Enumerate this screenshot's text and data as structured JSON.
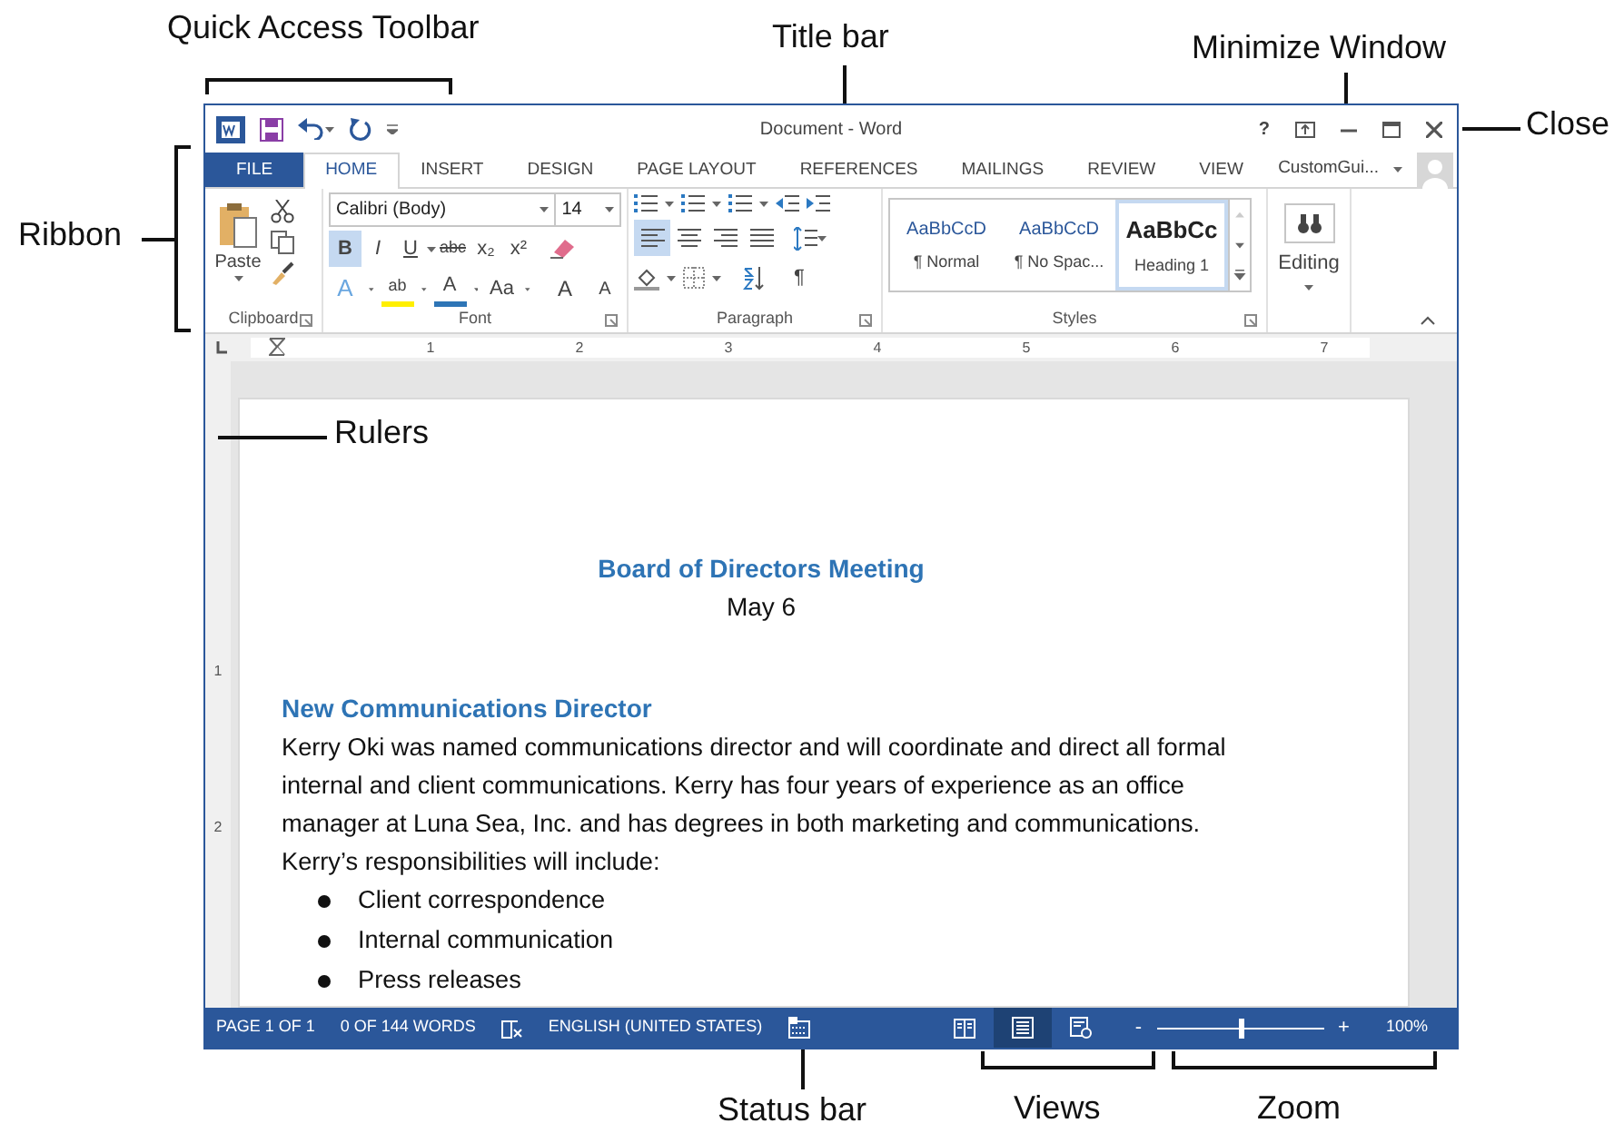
{
  "annotations": [
    {
      "label": "Quick Access Toolbar"
    },
    {
      "label": "Title bar"
    },
    {
      "label": "Minimize Window"
    },
    {
      "label": "Close"
    },
    {
      "label": "Ribbon"
    },
    {
      "label": "Rulers"
    },
    {
      "label": "Status bar"
    },
    {
      "label": "Views"
    },
    {
      "label": "Zoom"
    }
  ],
  "window": {
    "title": "Document - Word",
    "help": "?"
  },
  "tabs": [
    {
      "label": "FILE",
      "kind": "file",
      "selected": false
    },
    {
      "label": "HOME",
      "kind": "tab",
      "selected": true
    },
    {
      "label": "INSERT",
      "kind": "tab",
      "selected": false
    },
    {
      "label": "DESIGN",
      "kind": "tab",
      "selected": false
    },
    {
      "label": "PAGE LAYOUT",
      "kind": "tab",
      "selected": false
    },
    {
      "label": "REFERENCES",
      "kind": "tab",
      "selected": false
    },
    {
      "label": "MAILINGS",
      "kind": "tab",
      "selected": false
    },
    {
      "label": "REVIEW",
      "kind": "tab",
      "selected": false
    },
    {
      "label": "VIEW",
      "kind": "tab",
      "selected": false
    }
  ],
  "account": {
    "name": "CustomGui..."
  },
  "clipboard": {
    "label": "Clipboard",
    "paste": "Paste"
  },
  "font": {
    "label": "Font",
    "font_name": "Calibri (Body)",
    "font_size": "14",
    "format_buttons": [
      {
        "kind": "bold",
        "label": "B",
        "selected": true
      },
      {
        "kind": "italic",
        "label": "I",
        "selected": false
      },
      {
        "kind": "underline",
        "label": "U",
        "selected": false
      },
      {
        "kind": "strike",
        "label": "abc",
        "selected": false
      },
      {
        "kind": "plain",
        "label": "x₂",
        "selected": false
      },
      {
        "kind": "plain",
        "label": "x²",
        "selected": false
      }
    ],
    "effect_buttons": [
      {
        "kind": "effects",
        "label": "A"
      },
      {
        "kind": "highlight",
        "label": "ab"
      },
      {
        "kind": "color",
        "label": "A"
      },
      {
        "kind": "case",
        "label": "Aa"
      },
      {
        "kind": "grow",
        "label": "A"
      },
      {
        "kind": "shrink",
        "label": "A"
      }
    ]
  },
  "paragraph": {
    "label": "Paragraph",
    "align_buttons": [
      {
        "kind": "left",
        "selected": true
      },
      {
        "kind": "center",
        "selected": false
      },
      {
        "kind": "right",
        "selected": false
      },
      {
        "kind": "justify",
        "selected": false
      }
    ],
    "pilcrow": "¶"
  },
  "styles": {
    "label": "Styles",
    "items": [
      {
        "preview": "AaBbCcD",
        "name": "¶ Normal",
        "selected": false
      },
      {
        "preview": "AaBbCcD",
        "name": "¶ No Spac...",
        "selected": false
      },
      {
        "preview": "AaBbCc",
        "name": "Heading 1",
        "selected": true
      }
    ]
  },
  "editing": {
    "label": "Editing"
  },
  "ruler": [
    "1",
    "2",
    "3",
    "4",
    "5",
    "6",
    "7"
  ],
  "vertical_ruler": [
    "1",
    "2"
  ],
  "document": {
    "title": "Board of Directors Meeting",
    "date": "May 6",
    "heading": "New Communications Director",
    "paragraph": "Kerry Oki was named communications director and will coordinate and direct all formal internal and client communications. Kerry has four years of experience as an office manager at Luna Sea, Inc. and has degrees in both marketing and communications. Kerry’s responsibilities will include:",
    "bullets": [
      "Client correspondence",
      "Internal communication",
      "Press releases"
    ]
  },
  "status_bar": {
    "page": "PAGE 1 OF 1",
    "words": "0 OF 144 WORDS",
    "language": "ENGLISH (UNITED STATES)",
    "views": [
      {
        "kind": "read",
        "selected": false
      },
      {
        "kind": "print",
        "selected": true
      },
      {
        "kind": "web",
        "selected": false
      }
    ],
    "zoom_out": "-",
    "zoom_in": "+",
    "zoom": {
      "level": 0.5
    },
    "zoom_label": "100%"
  }
}
